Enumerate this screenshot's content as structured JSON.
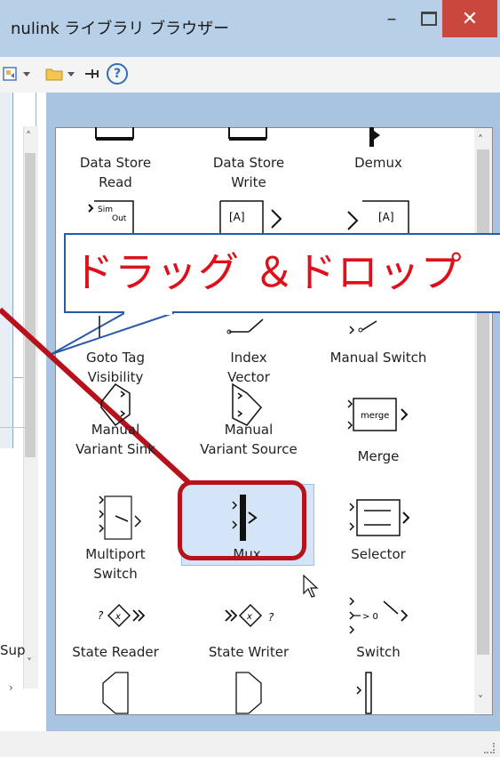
{
  "window": {
    "title": "nulink ライブラリ ブラウザー",
    "minimize_glyph": "–",
    "close_glyph": "✕"
  },
  "toolbar": {
    "help_glyph": "?"
  },
  "left_panel": {
    "partial_text": "Sup"
  },
  "blocks": [
    {
      "label_lines": [
        "Data Store",
        "Read"
      ],
      "icon": "data-store-read-icon"
    },
    {
      "label_lines": [
        "Data Store",
        "Write"
      ],
      "icon": "data-store-write-icon"
    },
    {
      "label_lines": [
        "Demux"
      ],
      "icon": "demux-icon"
    },
    {
      "label_lines": [
        "Goto Tag",
        "Visibility"
      ],
      "icon": "goto-tag-visibility-icon"
    },
    {
      "label_lines": [
        "Index",
        "Vector"
      ],
      "icon": "index-vector-icon"
    },
    {
      "label_lines": [
        "Manual Switch"
      ],
      "icon": "manual-switch-icon"
    },
    {
      "label_lines": [
        "Manual",
        "Variant Sink"
      ],
      "icon": "manual-variant-sink-icon"
    },
    {
      "label_lines": [
        "Manual",
        "Variant Source"
      ],
      "icon": "manual-variant-source-icon"
    },
    {
      "label_lines": [
        "Merge"
      ],
      "icon": "merge-icon"
    },
    {
      "label_lines": [
        "Multiport",
        "Switch"
      ],
      "icon": "multiport-switch-icon"
    },
    {
      "label_lines": [
        "Mux"
      ],
      "icon": "mux-icon"
    },
    {
      "label_lines": [
        "Selector"
      ],
      "icon": "selector-icon"
    },
    {
      "label_lines": [
        "State Reader"
      ],
      "icon": "state-reader-icon"
    },
    {
      "label_lines": [
        "State Writer"
      ],
      "icon": "state-writer-icon"
    },
    {
      "label_lines": [
        "Switch"
      ],
      "icon": "switch-icon"
    }
  ],
  "icon_text": {
    "sim": "Sim",
    "out": "Out",
    "goto_a": "[A]",
    "from_a": "[A]",
    "merge": "merge",
    "gt0": "> 0",
    "x": "x",
    "q": "?"
  },
  "annotation": {
    "text": "ドラッグ ＆ドロップ",
    "highlight_color": "#b7121c",
    "callout_border_color": "#2a59a8",
    "text_color": "#e0101a"
  }
}
